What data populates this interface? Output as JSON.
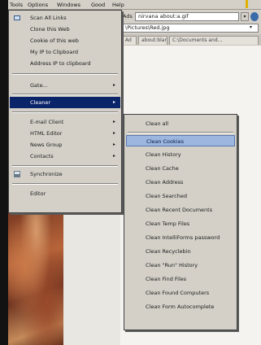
{
  "menubar": {
    "items": [
      "Tools",
      "Options",
      "Windows",
      "Good",
      "Help"
    ]
  },
  "address": {
    "label": "Ads",
    "value": "nirvana about:a.gif",
    "path": "\\Pictures\\Red.jpg"
  },
  "tabs": [
    "Ad",
    "about:blank",
    "C:\\Documents and..."
  ],
  "tools_menu": {
    "items": [
      {
        "label": "Scan All Links",
        "icon": "scan-icon"
      },
      {
        "label": "Clone this Web",
        "icon": ""
      },
      {
        "label": "Cookie of this web",
        "icon": ""
      },
      {
        "label": "My IP to Clipboard",
        "icon": ""
      },
      {
        "label": "Address IP to clipboard",
        "icon": ""
      },
      {
        "label": "Gate...",
        "submenu": true
      },
      {
        "label": "Cleaner",
        "submenu": true,
        "highlighted": true
      },
      {
        "label": "E-mail Client",
        "submenu": true
      },
      {
        "label": "HTML Editor",
        "submenu": true
      },
      {
        "label": "News Group",
        "submenu": true
      },
      {
        "label": "Contacts",
        "submenu": true
      },
      {
        "label": "Synchronize",
        "icon": "sync-icon"
      },
      {
        "label": "Editor",
        "icon": ""
      }
    ]
  },
  "cleaner_menu": {
    "items": [
      "Clean all",
      "Clean Cookies",
      "Clean History",
      "Clean Cache",
      "Clean Address",
      "Clean Searched",
      "Clean Recent Documents",
      "Clean Temp Files",
      "Clean IntelliForms password",
      "Clean Recyclebin",
      "Clean \"Run\" History",
      "Clean Find Files",
      "Clean Found Computers",
      "Clean Form Autocomplete"
    ],
    "highlighted_index": 1
  },
  "colors": {
    "menu_bg": "#d4d0c8",
    "highlight": "#0a246a",
    "submenu_highlight": "#9cb6e0"
  }
}
